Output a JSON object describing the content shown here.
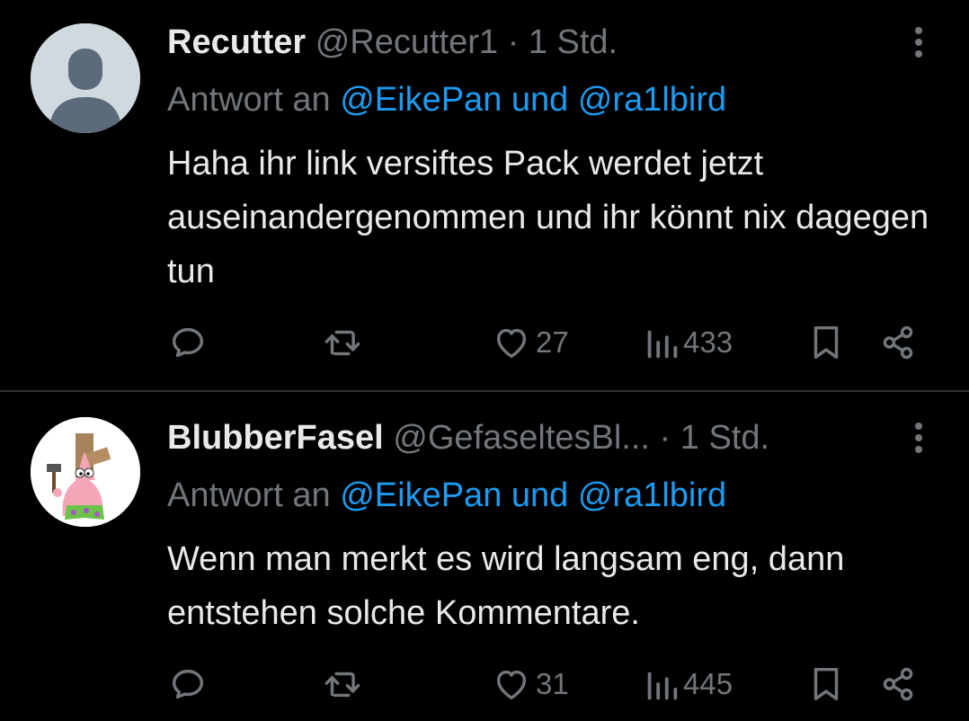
{
  "reply_prefix": "Antwort an",
  "colors": {
    "background": "#000000",
    "text": "#e7e9ea",
    "secondary": "#71767b",
    "link": "#1d9bf0",
    "divider": "#2f3336"
  },
  "tweets": [
    {
      "display_name": "Recutter",
      "handle": "@Recutter1",
      "separator": "·",
      "time": "1 Std.",
      "reply_to": "@EikePan und @ra1lbird",
      "text": "Haha ihr link versiftes Pack werdet jetzt auseinandergenommen und ihr könnt nix dagegen tun",
      "likes": "27",
      "views": "433",
      "avatar": "default-avatar-icon"
    },
    {
      "display_name": "BlubberFasel",
      "handle": "@GefaseltesBl...",
      "separator": "·",
      "time": "1 Std.",
      "reply_to": "@EikePan und @ra1lbird",
      "text": "Wenn man merkt es wird langsam eng, dann entstehen solche Kommentare.",
      "likes": "31",
      "views": "445",
      "avatar": "patrick-star-avatar"
    }
  ],
  "icons": {
    "reply": "reply-icon",
    "retweet": "retweet-icon",
    "like": "heart-icon",
    "views": "views-icon",
    "bookmark": "bookmark-icon",
    "share": "share-icon",
    "more": "more-icon"
  }
}
